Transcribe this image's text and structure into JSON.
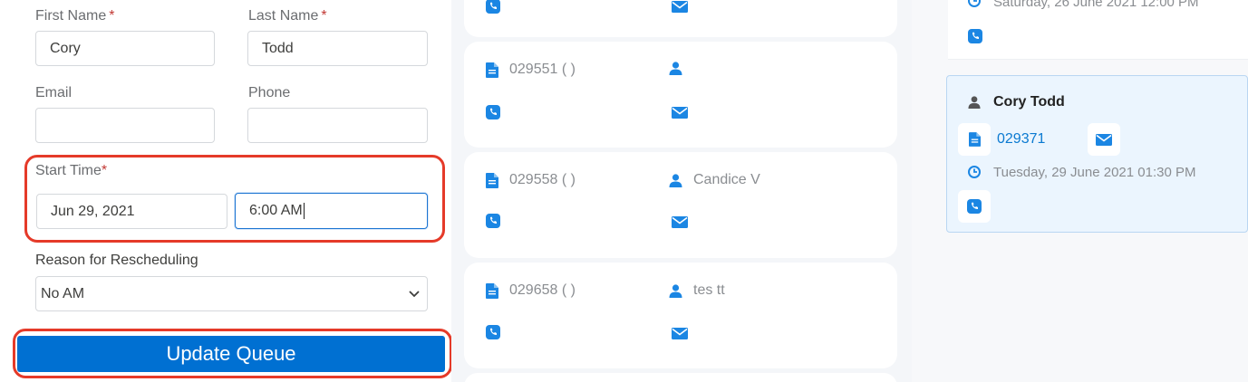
{
  "form": {
    "first_name_label": "First Name",
    "last_name_label": "Last Name",
    "first_name_value": "Cory",
    "last_name_value": "Todd",
    "email_label": "Email",
    "phone_label": "Phone",
    "email_value": "",
    "phone_value": "",
    "start_time_label": "Start Time",
    "start_date_value": "Jun 29, 2021",
    "start_time_value": "6:00 AM",
    "reason_label": "Reason for Rescheduling",
    "reason_value": "No AM",
    "required_marker": "*",
    "submit_label": "Update Queue"
  },
  "queue": {
    "cards": [
      {
        "id": "",
        "name": ""
      },
      {
        "id": "029551 ( )",
        "name": ""
      },
      {
        "id": "029558 ( )",
        "name": "Candice V"
      },
      {
        "id": "029658 ( )",
        "name": "tes tt"
      }
    ]
  },
  "right": {
    "top_time": "Saturday, 26 June 2021 12:00 PM",
    "selected": {
      "name": "Cory  Todd",
      "id": "029371",
      "time": "Tuesday, 29 June 2021 01:30 PM"
    }
  },
  "colors": {
    "accent": "#0070d2",
    "link": "#0b7ad1",
    "highlight": "#e53a29",
    "icon_blue": "#1b86e3"
  },
  "icons": [
    "document-icon",
    "user-icon",
    "phone-icon",
    "mail-icon",
    "clock-icon",
    "chevron-down-icon"
  ]
}
